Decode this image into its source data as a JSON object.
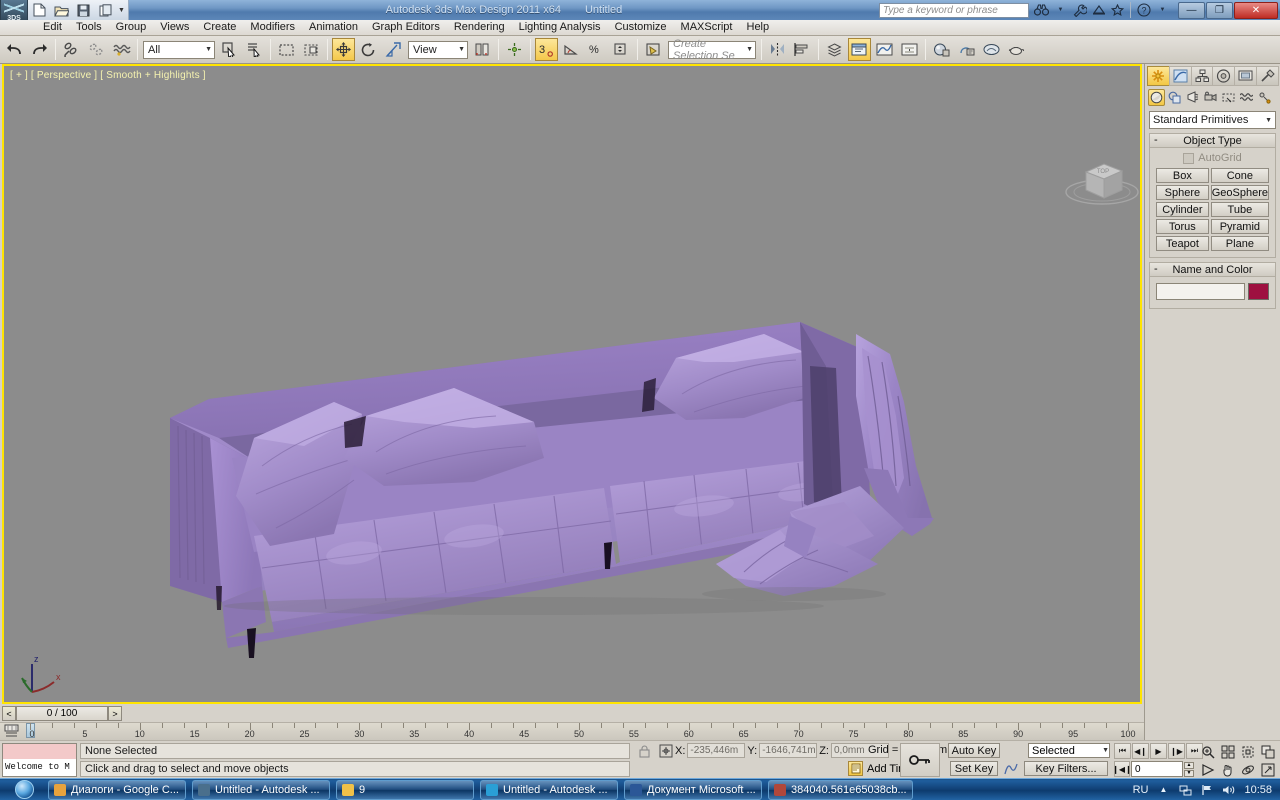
{
  "titlebar": {
    "app_title": "Autodesk 3ds Max Design 2011 x64",
    "document_title": "Untitled",
    "search_placeholder": "Type a keyword or phrase",
    "quick_access": [
      {
        "name": "new-file",
        "icon": "page-icon"
      },
      {
        "name": "open-file",
        "icon": "folder-open-icon"
      },
      {
        "name": "save-file",
        "icon": "floppy-icon"
      },
      {
        "name": "save-as",
        "icon": "copy-icon"
      }
    ],
    "info_icons": [
      "binoculars-icon",
      "wrench-icon",
      "subscription-icon",
      "star-icon",
      "help-icon"
    ],
    "window_buttons": {
      "minimize": "—",
      "restore": "❐",
      "close": "✕"
    }
  },
  "menu": {
    "items": [
      "Edit",
      "Tools",
      "Group",
      "Views",
      "Create",
      "Modifiers",
      "Animation",
      "Graph Editors",
      "Rendering",
      "Lighting Analysis",
      "Customize",
      "MAXScript",
      "Help"
    ]
  },
  "toolbar": {
    "selection_filter": "All",
    "reference_coord": "View",
    "named_selection_set": "Create Selection Se",
    "buttons": [
      {
        "name": "undo-button",
        "icon": "undo-icon",
        "active": false
      },
      {
        "name": "redo-button",
        "icon": "redo-icon",
        "active": false
      },
      {
        "name": "select-and-link-button",
        "icon": "link-icon",
        "active": false
      },
      {
        "name": "unlink-selection-button",
        "icon": "unlink-icon",
        "active": false
      },
      {
        "name": "bind-to-space-warp-button",
        "icon": "wave-icon",
        "active": false
      },
      {
        "name": "select-object-button",
        "icon": "cursor-arrow-icon",
        "active": false
      },
      {
        "name": "select-by-name-button",
        "icon": "list-cursor-icon",
        "active": false
      },
      {
        "name": "rectangular-selection-region-button",
        "icon": "dashed-rect-icon",
        "active": false
      },
      {
        "name": "window-crossing-button",
        "icon": "window-crossing-icon",
        "active": false
      },
      {
        "name": "select-and-move-button",
        "icon": "move-gizmo-icon",
        "active": true
      },
      {
        "name": "select-and-rotate-button",
        "icon": "rotate-icon",
        "active": false
      },
      {
        "name": "select-and-scale-button",
        "icon": "scale-icon",
        "active": false
      },
      {
        "name": "use-center-flyout-button",
        "icon": "pivot-center-icon",
        "active": false
      },
      {
        "name": "select-and-manipulate-button",
        "icon": "manipulate-icon",
        "active": false
      },
      {
        "name": "snaps-toggle-button",
        "icon": "snap-3-icon",
        "active": true
      },
      {
        "name": "angle-snap-button",
        "icon": "angle-snap-icon",
        "active": false
      },
      {
        "name": "percent-snap-button",
        "icon": "percent-snap-icon",
        "active": false
      },
      {
        "name": "spinner-snap-button",
        "icon": "spinner-snap-icon",
        "active": false
      },
      {
        "name": "edit-named-selection-sets-button",
        "icon": "named-sets-icon",
        "active": false
      },
      {
        "name": "mirror-button",
        "icon": "mirror-icon",
        "active": false
      },
      {
        "name": "align-button",
        "icon": "align-icon",
        "active": false
      },
      {
        "name": "layer-manager-button",
        "icon": "layers-icon",
        "active": false
      },
      {
        "name": "toggle-scene-explorer-button",
        "icon": "scene-explorer-icon",
        "active": true
      },
      {
        "name": "curve-editor-button",
        "icon": "curve-editor-icon",
        "active": false
      },
      {
        "name": "schematic-view-button",
        "icon": "schematic-icon",
        "active": false
      },
      {
        "name": "material-editor-button",
        "icon": "material-editor-icon",
        "active": false
      },
      {
        "name": "render-setup-button",
        "icon": "render-setup-icon",
        "active": false
      },
      {
        "name": "rendered-frame-window-button",
        "icon": "render-frame-icon",
        "active": false
      },
      {
        "name": "render-production-button",
        "icon": "teapot-render-icon",
        "active": false
      }
    ]
  },
  "viewport": {
    "label": "[ + ] [ Perspective ] [ Smooth + Highlights ]",
    "background_color": "#8c8c8c",
    "border_color": "#ffe400",
    "axis_tripod": {
      "x": "x",
      "y": "y",
      "z": "z"
    },
    "viewcube_label": "TOP",
    "scene": {
      "object": "purple tufted sofa with cushions and draped fabric throw",
      "material_color": "#9b80c9",
      "shadow_color": "#5a4f74"
    }
  },
  "command_panel": {
    "tabs": [
      {
        "name": "create-tab",
        "icon": "star-create-icon",
        "selected": true
      },
      {
        "name": "modify-tab",
        "icon": "modify-curve-icon",
        "selected": false
      },
      {
        "name": "hierarchy-tab",
        "icon": "hierarchy-icon",
        "selected": false
      },
      {
        "name": "motion-tab",
        "icon": "motion-wheel-icon",
        "selected": false
      },
      {
        "name": "display-tab",
        "icon": "display-monitor-icon",
        "selected": false
      },
      {
        "name": "utilities-tab",
        "icon": "hammer-icon",
        "selected": false
      }
    ],
    "subtabs": [
      {
        "name": "geometry-subtab",
        "icon": "sphere-icon",
        "selected": true
      },
      {
        "name": "shapes-subtab",
        "icon": "shapes-icon",
        "selected": false
      },
      {
        "name": "lights-subtab",
        "icon": "light-icon",
        "selected": false
      },
      {
        "name": "cameras-subtab",
        "icon": "camera-icon",
        "selected": false
      },
      {
        "name": "helpers-subtab",
        "icon": "helper-icon",
        "selected": false
      },
      {
        "name": "space-warps-subtab",
        "icon": "space-warp-icon",
        "selected": false
      },
      {
        "name": "systems-subtab",
        "icon": "systems-icon",
        "selected": false
      }
    ],
    "category": "Standard Primitives",
    "object_type": {
      "title": "Object Type",
      "autogrid_label": "AutoGrid",
      "autogrid_checked": false,
      "buttons": [
        "Box",
        "Cone",
        "Sphere",
        "GeoSphere",
        "Cylinder",
        "Tube",
        "Torus",
        "Pyramid",
        "Teapot",
        "Plane"
      ]
    },
    "name_and_color": {
      "title": "Name and Color",
      "name_value": "",
      "color": "#9e1040"
    }
  },
  "trackbar": {
    "frame_display": "0 / 100",
    "prev_arrow": "<",
    "next_arrow": ">",
    "ruler_min": 0,
    "ruler_max": 100,
    "ruler_labels": [
      5,
      10,
      15,
      20,
      25,
      30,
      35,
      40,
      45,
      50,
      55,
      60,
      65,
      70,
      75,
      80,
      85,
      90,
      95,
      100
    ],
    "slider_frame": 0
  },
  "status": {
    "maxscript_mini_listener": "Welcome to M",
    "selection_status": "None Selected",
    "prompt": "Click and drag to select and move objects",
    "lock_selection_icon": "padlock-icon",
    "coordinates": [
      {
        "axis": "X:",
        "value": "-235,446m"
      },
      {
        "axis": "Y:",
        "value": "-1646,741m"
      },
      {
        "axis": "Z:",
        "value": "0,0mm"
      }
    ],
    "grid": "Grid = 100,0mm",
    "add_time_tag": "Add Time Tag",
    "key_mode_icon": "key-icon",
    "auto_key": "Auto Key",
    "set_key": "Set Key",
    "key_filters": "Key Filters...",
    "selection_level": "Selected",
    "current_frame": "0",
    "playback_buttons": [
      "go-to-start-icon",
      "previous-frame-icon",
      "play-icon",
      "next-frame-icon",
      "go-to-end-icon"
    ],
    "nav_buttons": [
      "zoom-icon",
      "zoom-all-icon",
      "zoom-extents-icon",
      "zoom-region-icon",
      "field-of-view-icon",
      "pan-icon",
      "orbit-icon",
      "maximize-viewport-icon"
    ]
  },
  "taskbar": {
    "start_label": "",
    "items": [
      {
        "label": "Диалоги - Google C...",
        "icon": "chrome-icon",
        "color": "#e8a33d"
      },
      {
        "label": "Untitled - Autodesk ...",
        "icon": "max-icon",
        "color": "#4a6f8c"
      },
      {
        "label": "9",
        "icon": "folder-icon",
        "color": "#f0c148"
      },
      {
        "label": "Untitled - Autodesk ...",
        "icon": "max-app-icon",
        "color": "#2a9fd6"
      },
      {
        "label": "Документ Microsoft ...",
        "icon": "word-icon",
        "color": "#2b5797"
      },
      {
        "label": "384040.561e65038cb...",
        "icon": "archive-icon",
        "color": "#b0473b"
      }
    ],
    "tray": {
      "language": "RU",
      "icons": [
        "show-hidden-icons",
        "network-icon",
        "flag-icon",
        "volume-icon"
      ],
      "clock": "10:58"
    }
  }
}
